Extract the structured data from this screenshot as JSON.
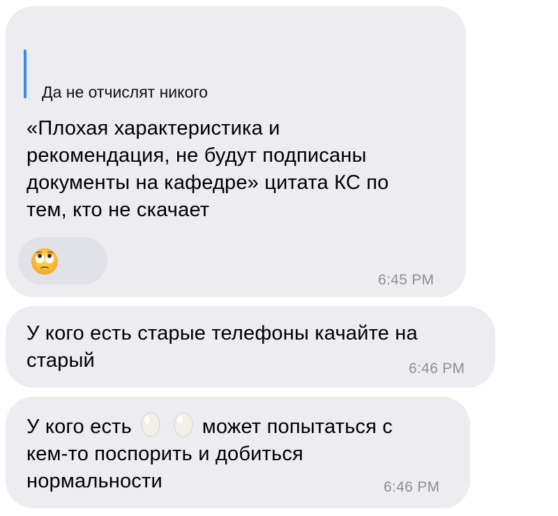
{
  "messages": [
    {
      "reply": "Да не отчислят никого",
      "lines": [
        "«Плохая характеристика и",
        "рекомендация, не будут подписаны",
        "документы на кафедре» цитата КС по",
        "тем, кто не скачает"
      ],
      "reaction": "eye-roll-emoji",
      "time": "6:45 PM"
    },
    {
      "lines": [
        "У кого есть старые телефоны качайте на",
        "старый"
      ],
      "time": "6:46 PM"
    },
    {
      "line1_before": "У кого есть",
      "line1_after": "может попытаться с",
      "lines_rest": [
        "кем-то поспорить и добиться",
        "нормальности"
      ],
      "inline_icons": [
        "egg-icon",
        "egg-icon"
      ],
      "time": "6:46 PM"
    }
  ],
  "colors": {
    "bubble": "#ececf1",
    "reply_bar": "#2d8cf0",
    "time": "#8e8e93"
  }
}
